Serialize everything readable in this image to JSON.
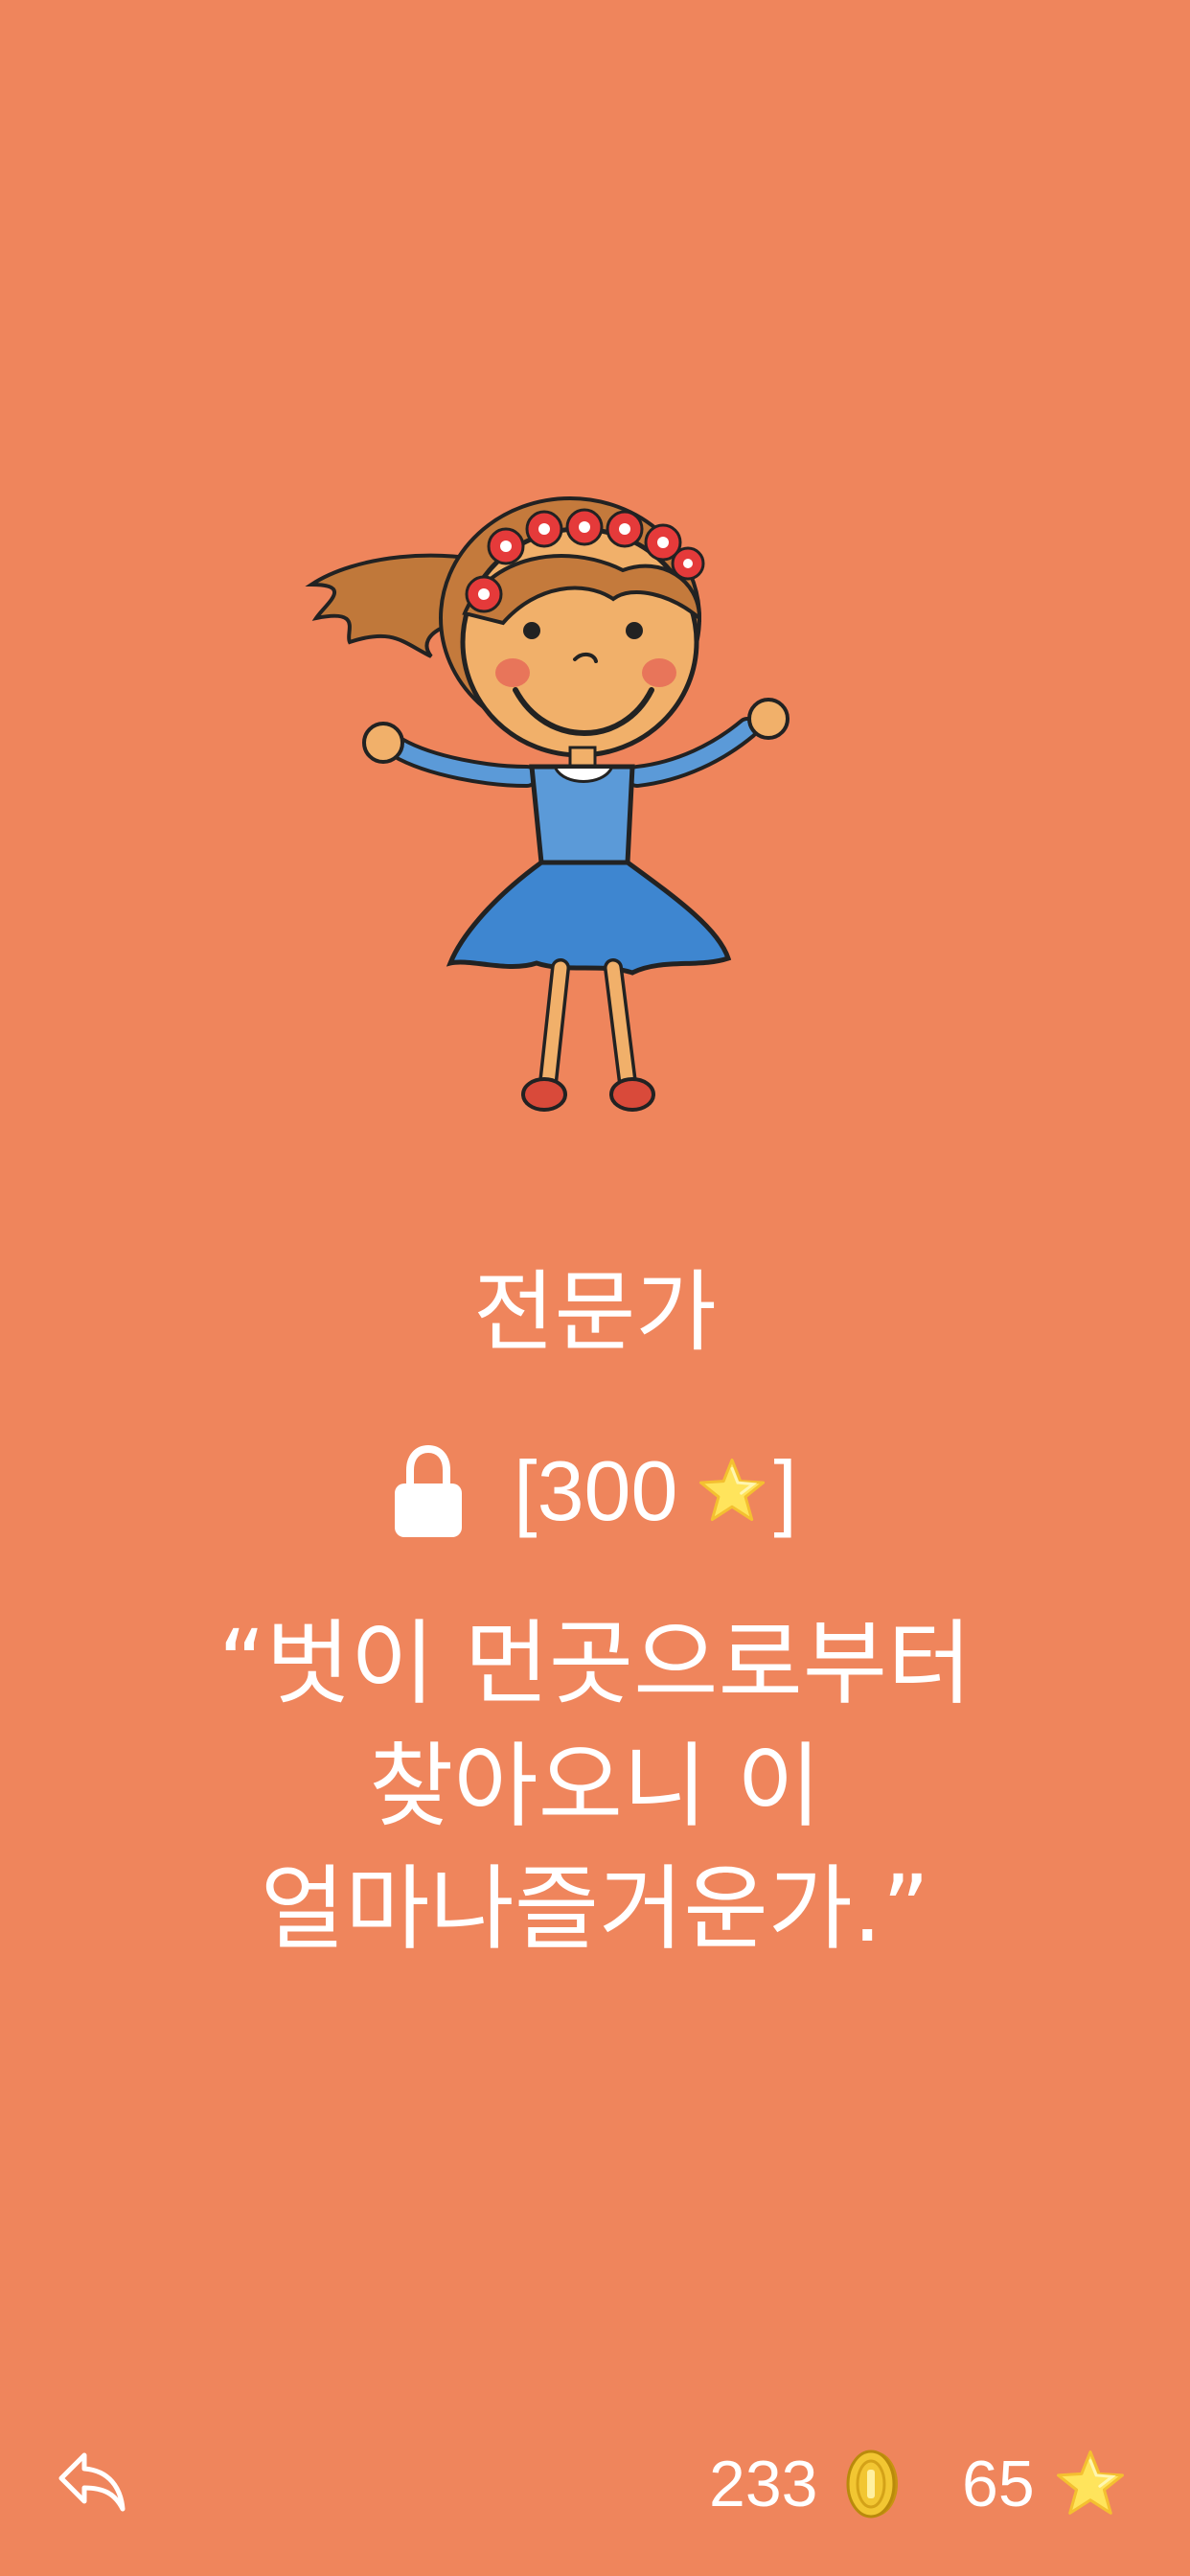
{
  "colors": {
    "background": "#EF855C",
    "text": "#FFFFFF",
    "star": "#FFE45C",
    "coin": "#E8B820"
  },
  "character": {
    "icon": "dancing-girl-illustration"
  },
  "level": {
    "title": "전문가",
    "lock_icon": "lock-icon",
    "price_open": "[300",
    "price_close": "]",
    "price_icon": "star-icon"
  },
  "quote": {
    "text": "“벗이 먼곳으로부터 찾아오니 이 얼마나즐거운가.”"
  },
  "footer": {
    "back_icon": "reply-arrow-icon",
    "coins": "233",
    "coin_icon": "coin-icon",
    "stars": "65",
    "star_icon": "star-icon"
  }
}
